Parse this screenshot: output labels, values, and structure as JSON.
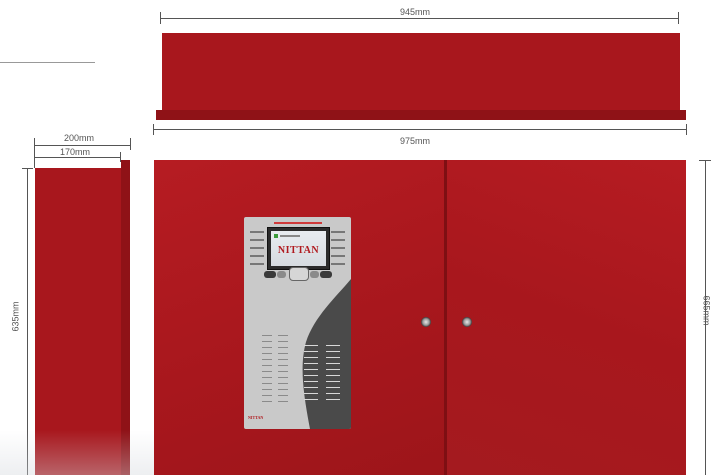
{
  "dimensions": {
    "top_width": "945mm",
    "front_width": "975mm",
    "side_depth_outer": "200mm",
    "side_depth_inner": "170mm",
    "side_height": "635mm",
    "front_height": "665mm"
  },
  "panel": {
    "brand": "NITTAN"
  },
  "colors": {
    "cabinet_red": "#a8171d",
    "panel_grey": "#c9c9c9",
    "panel_dark": "#4a4a4a",
    "screen_dark": "#2b2b2b"
  }
}
